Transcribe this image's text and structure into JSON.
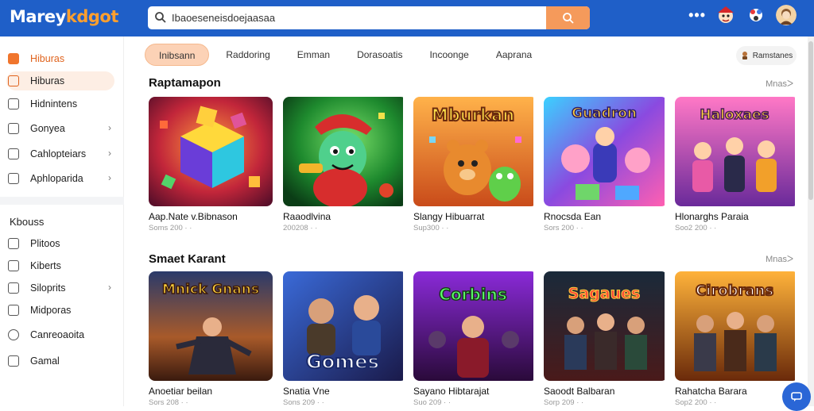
{
  "header": {
    "logo_main": "Marey",
    "logo_accent": "kdgot",
    "search_value": "Ibaoeseneisdoejaasaa",
    "more_label": "•••"
  },
  "sidebar": {
    "items": [
      {
        "label": "Hiburas",
        "chev": ""
      },
      {
        "label": "Hiburas",
        "chev": ""
      },
      {
        "label": "Hidnintens",
        "chev": ""
      },
      {
        "label": "Gonyea",
        "chev": "›"
      },
      {
        "label": "Cahlopteiars",
        "chev": "›"
      },
      {
        "label": "Aphloparida",
        "chev": "›"
      }
    ],
    "heading": "Kbouss",
    "items2": [
      {
        "label": "Plitoos",
        "chev": ""
      },
      {
        "label": "Kiberts",
        "chev": ""
      },
      {
        "label": "Siloprits",
        "chev": "›"
      },
      {
        "label": "Midporas",
        "chev": ""
      },
      {
        "label": "Canreoaoita",
        "chev": ""
      },
      {
        "label": "Gamal",
        "chev": ""
      }
    ]
  },
  "tabs": [
    "Inibsann",
    "Raddoring",
    "Emman",
    "Dorasoatis",
    "Incoonge",
    "Aaprana"
  ],
  "filter_label": "Ramstanes",
  "sections": [
    {
      "title": "Raptamapon",
      "more": "Mnasᐳ",
      "cards": [
        {
          "name": "Aap.Nate v.Bibnason",
          "meta": "Soms 200   ·   ·",
          "art": "cubes",
          "title": ""
        },
        {
          "name": "Raaodlvina",
          "meta": "200208   ·   ·",
          "art": "frog",
          "title": ""
        },
        {
          "name": "Slangy Hibuarrat",
          "meta": "Sup300   ·   ·",
          "art": "bears",
          "title": "Mburkan"
        },
        {
          "name": "Rnocsda Ean",
          "meta": "Sors 200   ·   ·",
          "art": "party",
          "title": "Guadron"
        },
        {
          "name": "Hlonarghs Paraia",
          "meta": "Soo2 200   ·   ·",
          "art": "heroes",
          "title": "Haloxaes"
        }
      ]
    },
    {
      "title": "Smaet Karant",
      "more": "Mnasᐳ",
      "cards": [
        {
          "name": "Anoetiar beilan",
          "meta": "Sors 208   ·   ·",
          "art": "warrior",
          "title": "Mnick Gnans"
        },
        {
          "name": "Snatia Vne",
          "meta": "Sons 209   ·   ·",
          "art": "gomes",
          "title": "Gomes"
        },
        {
          "name": "Sayano Hibtarajat",
          "meta": "Suo 209   ·   ·",
          "art": "corbins",
          "title": "Corbins"
        },
        {
          "name": "Saoodt Balbaran",
          "meta": "Sorp 209   ·   ·",
          "art": "sagaues",
          "title": "Sagaues"
        },
        {
          "name": "Rahatcha Barara",
          "meta": "Sop2 200   ·   ·",
          "art": "cirobrans",
          "title": "Cirobrans"
        }
      ]
    }
  ],
  "colors": {
    "brand_blue": "#1f5fc8",
    "accent_orange": "#f59a5b",
    "active_tab_bg": "#fcd2b6"
  }
}
